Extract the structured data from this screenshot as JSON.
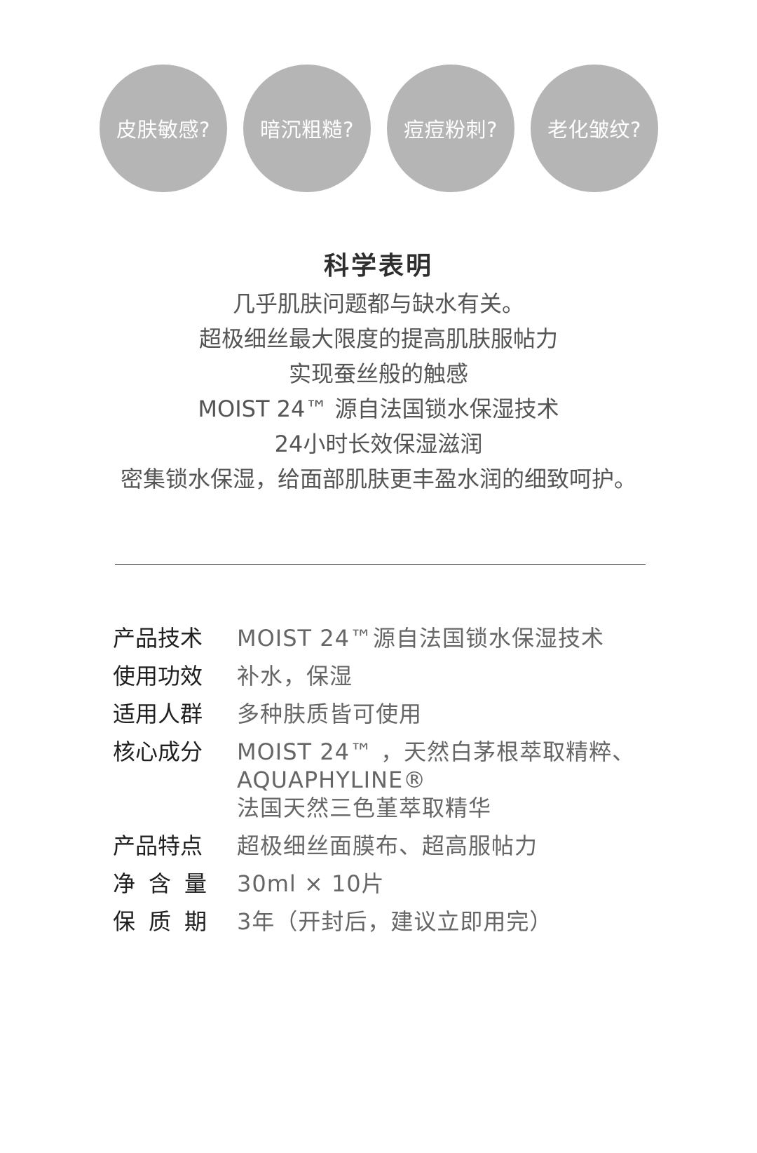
{
  "concerns": [
    {
      "label": "皮肤敏感?"
    },
    {
      "label": "暗沉粗糙?"
    },
    {
      "label": "痘痘粉刺?"
    },
    {
      "label": "老化皱纹?"
    }
  ],
  "science": {
    "title": "科学表明",
    "lines": [
      "几乎肌肤问题都与缺水有关。",
      "超极细丝最大限度的提高肌肤服帖力",
      "实现蚕丝般的触感",
      "MOIST 24™ 源自法国锁水保湿技术",
      "24小时长效保湿滋润",
      "密集锁水保湿，给面部肌肤更丰盈水润的细致呵护。"
    ]
  },
  "specs": [
    {
      "label": "产品技术",
      "values": [
        "MOIST 24™源自法国锁水保湿技术"
      ]
    },
    {
      "label": "使用功效",
      "values": [
        "补水，保湿"
      ]
    },
    {
      "label": "适用人群",
      "values": [
        "多种肤质皆可使用"
      ]
    },
    {
      "label": "核心成分",
      "values": [
        "MOIST 24™ ，天然白茅根萃取精粹、",
        "AQUAPHYLINE®",
        "法国天然三色堇萃取精华"
      ]
    },
    {
      "label": "产品特点",
      "values": [
        "超极细丝面膜布、超高服帖力"
      ]
    },
    {
      "label": "净含量",
      "values": [
        "30ml × 10片"
      ]
    },
    {
      "label": "保质期",
      "values": [
        "3年（开封后，建议立即用完）"
      ]
    }
  ],
  "colors": {
    "circle": "#b5b5b5",
    "circle_text": "#ffffff",
    "label_text": "#1f1f1f",
    "value_text": "#666666",
    "divider": "#333333"
  }
}
